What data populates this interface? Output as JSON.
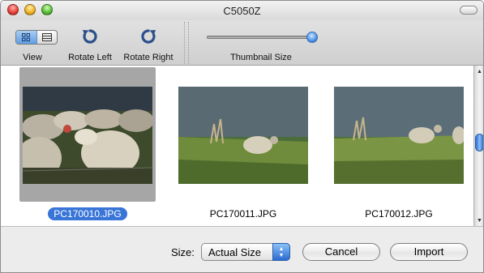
{
  "window": {
    "title": "C5050Z"
  },
  "toolbar": {
    "view_label": "View",
    "rotate_left_label": "Rotate Left",
    "rotate_right_label": "Rotate Right",
    "thumbnail_size_label": "Thumbnail Size",
    "thumbnail_size_value": 1.0,
    "view_mode_selected": "icon"
  },
  "thumbnails": [
    {
      "filename": "PC170010.JPG",
      "selected": true
    },
    {
      "filename": "PC170011.JPG",
      "selected": false
    },
    {
      "filename": "PC170012.JPG",
      "selected": false
    }
  ],
  "footer": {
    "size_label": "Size:",
    "size_value": "Actual Size",
    "cancel_label": "Cancel",
    "import_label": "Import"
  },
  "colors": {
    "selection_accent": "#3875d7",
    "selected_cell_bg": "#a6a6a6"
  }
}
